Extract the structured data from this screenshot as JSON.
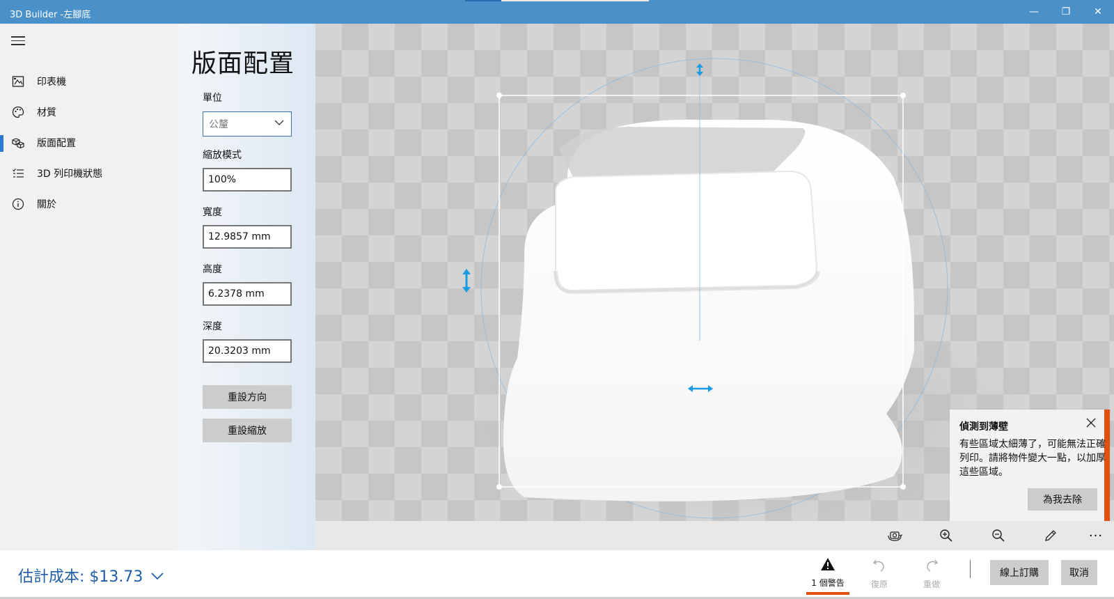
{
  "window": {
    "title": "3D Builder -左腳底",
    "minimize_glyph": "—",
    "maximize_glyph": "❐",
    "close_glyph": "✕"
  },
  "nav": {
    "items": [
      {
        "label": "印表機",
        "icon": "printer-icon",
        "active": false
      },
      {
        "label": "材質",
        "icon": "palette-icon",
        "active": false
      },
      {
        "label": "版面配置",
        "icon": "layout-cubes-icon",
        "active": true
      },
      {
        "label": "3D 列印機狀態",
        "icon": "status-list-icon",
        "active": false
      },
      {
        "label": "關於",
        "icon": "info-icon",
        "active": false
      }
    ]
  },
  "props": {
    "heading": "版面配置",
    "unit_label": "單位",
    "unit_value": "公釐",
    "scale_mode_label": "縮放模式",
    "scale_value": "100%",
    "width_label": "寬度",
    "width_value": "12.9857 mm",
    "height_label": "高度",
    "height_value": "6.2378 mm",
    "depth_label": "深度",
    "depth_value": "20.3203 mm",
    "reset_orientation": "重設方向",
    "reset_scale": "重設縮放"
  },
  "toast": {
    "title": "偵測到薄壁",
    "body": "有些區域太細薄了，可能無法正確列印。請將物件變大一點，以加厚這些區域。",
    "button": "為我去除",
    "accent_color": "#e1500e"
  },
  "viewtools": {
    "items": [
      "camera-rotate-icon",
      "zoom-in-icon",
      "zoom-out-icon",
      "pencil-icon",
      "more-icon"
    ],
    "more_glyph": "···"
  },
  "bottom": {
    "cost_label": "估計成本: $13.73",
    "warnings_label": "1 個警告",
    "undo_label": "復原",
    "redo_label": "重做",
    "order_label": "線上訂購",
    "cancel_label": "取消"
  },
  "colors": {
    "titlebar": "#4a90c9",
    "accent_blue": "#2b7ad1",
    "cost_blue": "#1e5fa8",
    "warning_orange": "#e1500e"
  }
}
